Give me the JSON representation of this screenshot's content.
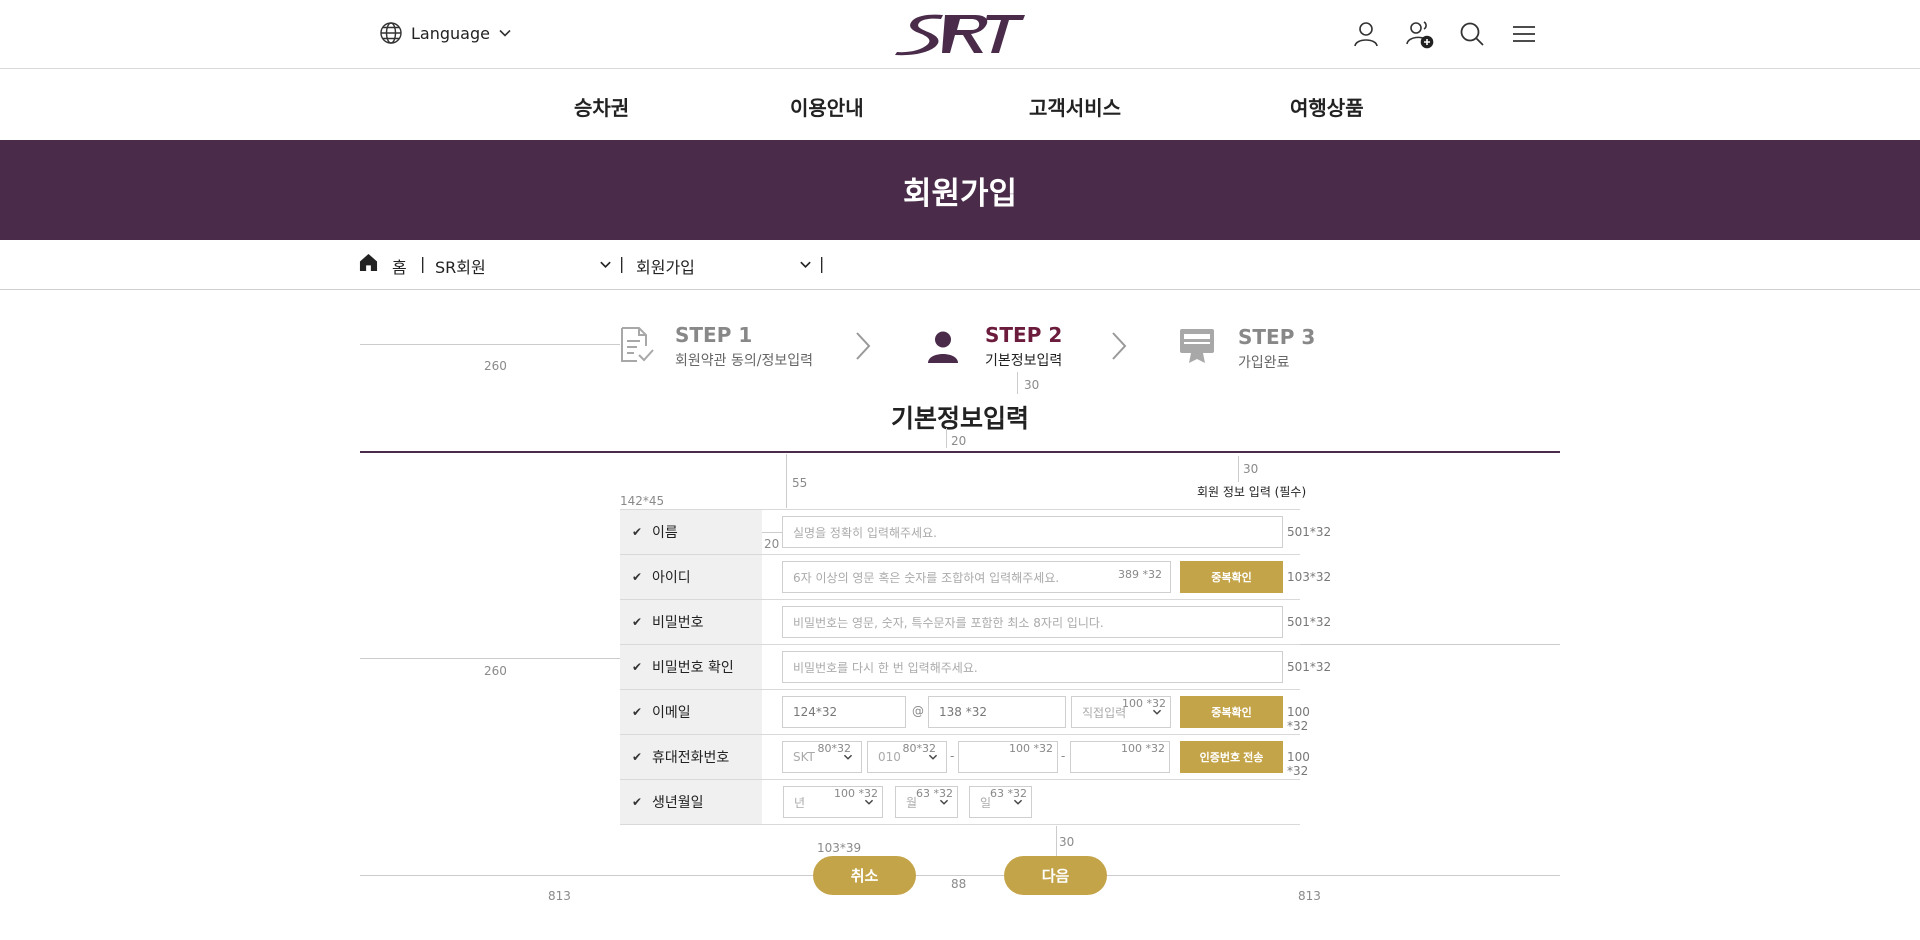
{
  "header": {
    "language_label": "Language",
    "icons": [
      "globe-icon",
      "chevron-down-icon",
      "user-icon",
      "user-add-icon",
      "search-icon",
      "menu-icon"
    ],
    "logo_text": "SRT"
  },
  "nav": {
    "items": [
      {
        "label": "승차권"
      },
      {
        "label": "이용안내"
      },
      {
        "label": "고객서비스"
      },
      {
        "label": "여행상품"
      }
    ]
  },
  "banner": {
    "title": "회원가입"
  },
  "breadcrumb": {
    "home": "홈",
    "sep": "|",
    "level1": "SR회원",
    "level2": "회원가입"
  },
  "steps": [
    {
      "title": "STEP 1",
      "sub": "회원약관 동의/정보입력",
      "icon": "document-check-icon",
      "active": false
    },
    {
      "title": "STEP 2",
      "sub": "기본정보입력",
      "icon": "person-icon",
      "active": true
    },
    {
      "title": "STEP 3",
      "sub": "가입완료",
      "icon": "monitor-icon",
      "active": false
    }
  ],
  "section": {
    "title": "기본정보입력",
    "required_note": "회원 정보 입력 (필수)"
  },
  "form": {
    "rows": [
      {
        "label": "이름",
        "placeholder": "실명을 정확히 입력해주세요.",
        "size": "501*32"
      },
      {
        "label": "아이디",
        "placeholder": "6자 이상의 영문 혹은 숫자를 조합하여 입력해주세요.",
        "inner_size": "389 *32",
        "button": "중복확인",
        "size": "103*32"
      },
      {
        "label": "비밀번호",
        "placeholder": "비밀번호는 영문, 숫자, 특수문자를 포함한 최소 8자리 입니다.",
        "size": "501*32"
      },
      {
        "label": "비밀번호 확인",
        "placeholder": "비밀번호를 다시 한 번 입력해주세요.",
        "size": "501*32"
      },
      {
        "label": "이메일",
        "email_local": "124*32",
        "at": "@",
        "email_domain": "138 *32",
        "direct": "직접입력",
        "direct_size": "100 *32",
        "button": "중복확인",
        "size": "100 *32"
      },
      {
        "label": "휴대전화번호",
        "carrier": "SKT",
        "carrier_size": "80*32",
        "prefix": "010",
        "prefix_size": "80*32",
        "dash": "-",
        "mid_size": "100 *32",
        "last_size": "100 *32",
        "button": "인증번호 전송",
        "size": "100 *32"
      },
      {
        "label": "생년월일",
        "year": "년",
        "year_size": "100 *32",
        "month": "월",
        "month_size": "63 *32",
        "day": "일",
        "day_size": "63 *32"
      }
    ]
  },
  "buttons": {
    "cancel": "취소",
    "next": "다음"
  },
  "annotations": {
    "d260": "260",
    "d30": "30",
    "d20": "20",
    "d55": "55",
    "d142x45": "142*45",
    "d103x39": "103*39",
    "d88": "88",
    "d813": "813"
  },
  "colors": {
    "brand": "#4a2c4a",
    "accent": "#6b1b3c",
    "gold": "#c4a449"
  }
}
